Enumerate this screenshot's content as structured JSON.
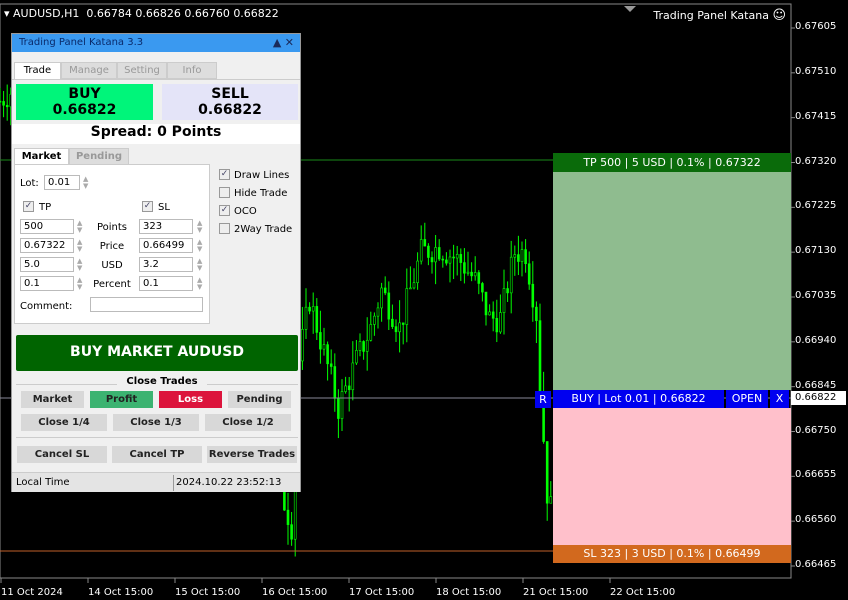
{
  "chart_header": {
    "symbol": "AUDUSD,H1",
    "ohlc": "0.66784 0.66826 0.66760 0.66822",
    "brand": "Trading Panel Katana",
    "smile_icon": "☺"
  },
  "panel": {
    "title": "Trading Panel Katana 3.3",
    "controls": "▲ ✕",
    "tabs": [
      "Trade",
      "Manage",
      "Setting",
      "Info"
    ],
    "buy": {
      "label": "BUY",
      "price": "0.66822",
      "color": "#00f57a"
    },
    "sell": {
      "label": "SELL",
      "price": "0.66822",
      "color": "#e4e4f8"
    },
    "spread": "Spread: 0 Points",
    "subtabs": [
      "Market",
      "Pending"
    ],
    "lot_label": "Lot:",
    "lot": "0.01",
    "tp_label": "TP",
    "sl_label": "SL",
    "tp_checked": true,
    "sl_checked": true,
    "rows": [
      {
        "label": "Points",
        "tp": "500",
        "sl": "323"
      },
      {
        "label": "Price",
        "tp": "0.67322",
        "sl": "0.66499"
      },
      {
        "label": "USD",
        "tp": "5.0",
        "sl": "3.2"
      },
      {
        "label": "Percent",
        "tp": "0.1",
        "sl": "0.1"
      }
    ],
    "comment_label": "Comment:",
    "comment": "",
    "options": [
      {
        "label": "Draw Lines",
        "checked": true
      },
      {
        "label": "Hide Trade",
        "checked": false
      },
      {
        "label": "OCO",
        "checked": true
      },
      {
        "label": "2Way Trade",
        "checked": false
      }
    ],
    "market_button": "BUY MARKET AUDUSD",
    "close_trades_label": "Close Trades",
    "close_row1": [
      "Market",
      "Profit",
      "Loss",
      "Pending"
    ],
    "close_row2": [
      "Close 1/4",
      "Close 1/3",
      "Close 1/2"
    ],
    "close_row3": [
      "Cancel SL",
      "Cancel TP",
      "Reverse Trades"
    ],
    "status_label": "Local Time",
    "status_time": "2024.10.22 23:52:13"
  },
  "trade_overlay": {
    "tp": "TP 500 | 5 USD | 0.1% | 0.67322",
    "order": "BUY | Lot 0.01 | 0.66822",
    "r": "R",
    "open": "OPEN",
    "x": "X",
    "sl": "SL 323 | 3 USD | 0.1% | 0.66499",
    "colors": {
      "tp_head": "#0a6b0a",
      "tp_zone": "#8fbc8f",
      "order": "#0000f0",
      "sl_zone": "#ffc0cb",
      "sl_head": "#d2691e"
    }
  },
  "chart_data": {
    "type": "candlestick",
    "color": "#00ff00",
    "ylim": [
      0.66465,
      0.67605
    ],
    "yticks": [
      "0.67605",
      "0.67510",
      "0.67415",
      "0.67320",
      "0.67225",
      "0.67130",
      "0.67035",
      "0.66940",
      "0.66845",
      "0.66750",
      "0.66655",
      "0.66560",
      "0.66465"
    ],
    "current_price": "0.66822",
    "xticks": [
      "11 Oct 2024",
      "14 Oct 15:00",
      "15 Oct 15:00",
      "16 Oct 15:00",
      "17 Oct 15:00",
      "18 Oct 15:00",
      "21 Oct 15:00",
      "22 Oct 15:00"
    ],
    "waypoints": [
      [
        0,
        0.6745
      ],
      [
        3,
        0.6747
      ],
      [
        11,
        0.6735
      ],
      [
        28,
        0.6715
      ],
      [
        56,
        0.67
      ],
      [
        75,
        0.667
      ],
      [
        81,
        0.6655
      ],
      [
        83,
        0.669
      ],
      [
        86,
        0.6703
      ],
      [
        92,
        0.6686
      ],
      [
        94,
        0.668
      ],
      [
        99,
        0.669
      ],
      [
        103,
        0.6697
      ],
      [
        106,
        0.6705
      ],
      [
        111,
        0.6697
      ],
      [
        117,
        0.6713
      ],
      [
        122,
        0.6714
      ],
      [
        128,
        0.6711
      ],
      [
        132,
        0.6707
      ],
      [
        136,
        0.6699
      ],
      [
        139,
        0.6699
      ],
      [
        143,
        0.6713
      ],
      [
        146,
        0.6713
      ],
      [
        149,
        0.67
      ],
      [
        150,
        0.6685
      ],
      [
        152,
        0.6662
      ],
      [
        154,
        0.6656
      ]
    ]
  }
}
